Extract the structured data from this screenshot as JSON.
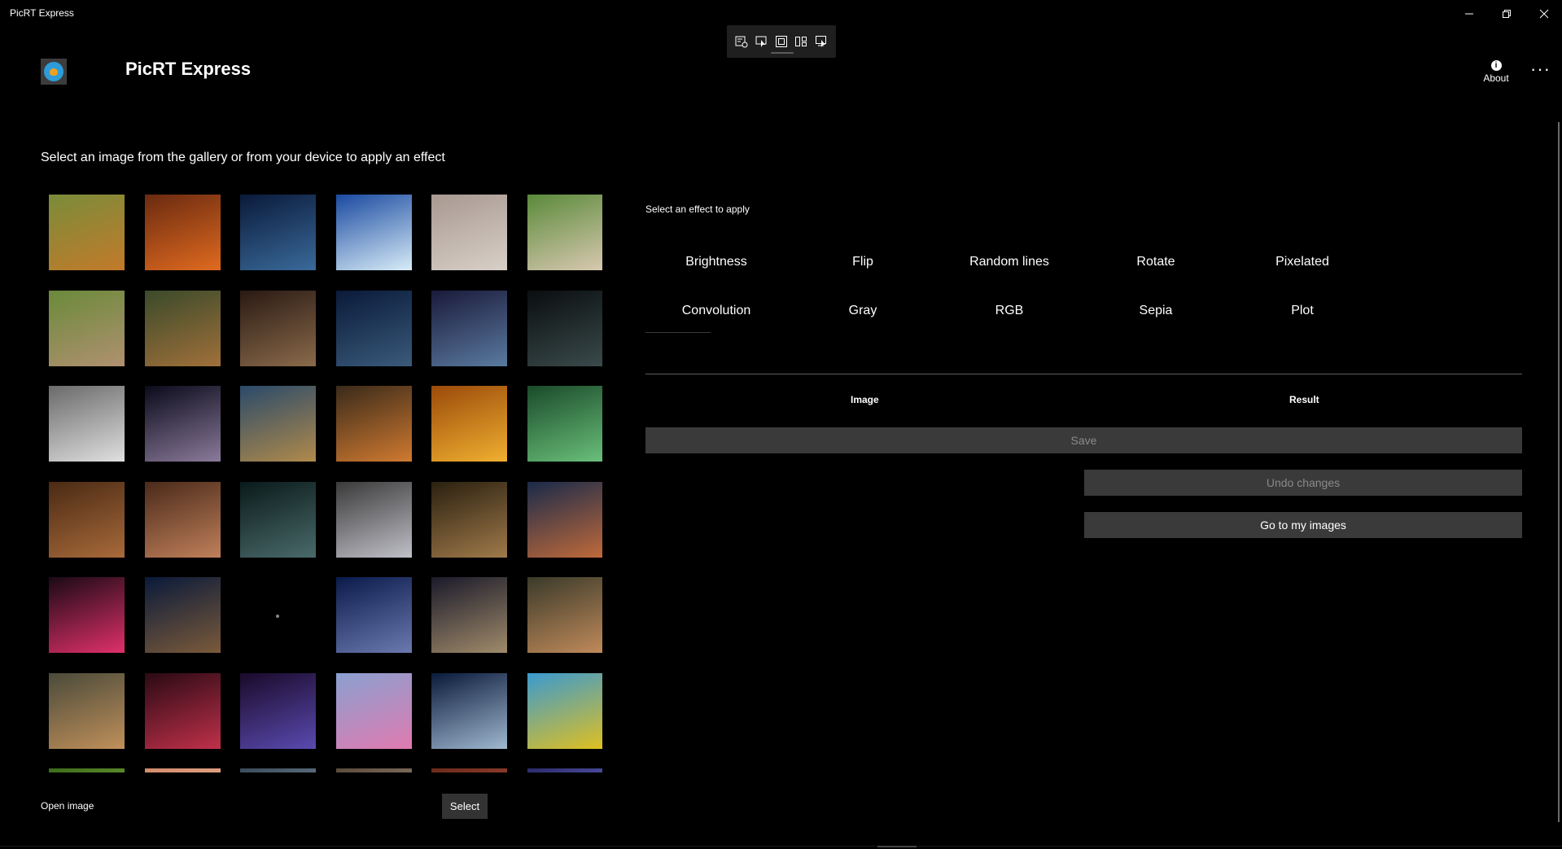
{
  "window": {
    "title": "PicRT Express",
    "controls": [
      "minimize-icon",
      "restore-icon",
      "close-icon"
    ]
  },
  "dev_toolbar": {
    "icons": [
      "toggle-visual-tree-icon",
      "select-element-icon",
      "display-layout-adorners-icon",
      "track-focused-element-icon",
      "hot-reload-icon"
    ]
  },
  "header": {
    "app_name": "PicRT Express",
    "about_label": "About",
    "more_label": "···"
  },
  "instruction": "Select an image from the gallery or from your device to apply an effect",
  "gallery": {
    "thumbnails": [
      {
        "name": "corgi",
        "c1": "#7a8c3a",
        "c2": "#c27a2a"
      },
      {
        "name": "cave-sunset",
        "c1": "#6a2a10",
        "c2": "#e06a20"
      },
      {
        "name": "starry-sky-rock",
        "c1": "#0a1a3a",
        "c2": "#3a6a9a"
      },
      {
        "name": "glacier",
        "c1": "#1a4aa0",
        "c2": "#d8ecf8"
      },
      {
        "name": "cat",
        "c1": "#a89890",
        "c2": "#d8d0c8"
      },
      {
        "name": "rabbit",
        "c1": "#5a8a3a",
        "c2": "#d8c8b0"
      },
      {
        "name": "cat-in-grass",
        "c1": "#6a8a3a",
        "c2": "#b09070"
      },
      {
        "name": "tiger-lying",
        "c1": "#3a4a2a",
        "c2": "#a0703a"
      },
      {
        "name": "abandoned-room",
        "c1": "#2a1a14",
        "c2": "#8a6a4a"
      },
      {
        "name": "old-train",
        "c1": "#0a1a3a",
        "c2": "#3a5a7a"
      },
      {
        "name": "tent-night",
        "c1": "#1a1a3a",
        "c2": "#5a7aa0"
      },
      {
        "name": "dark-coast",
        "c1": "#0a0e10",
        "c2": "#3a4a4a"
      },
      {
        "name": "goats-snow",
        "c1": "#6a6a6a",
        "c2": "#e0e0e0"
      },
      {
        "name": "space-planet",
        "c1": "#0a0a1a",
        "c2": "#8a7a9a"
      },
      {
        "name": "owl-autumn",
        "c1": "#2a4a6a",
        "c2": "#b08a4a"
      },
      {
        "name": "tiger-water",
        "c1": "#3a2a1a",
        "c2": "#d07a30"
      },
      {
        "name": "golden-valley",
        "c1": "#9a4a0a",
        "c2": "#f0b030"
      },
      {
        "name": "circuit-board",
        "c1": "#1a4a2a",
        "c2": "#6ac07a"
      },
      {
        "name": "bolt-wood",
        "c1": "#4a2a14",
        "c2": "#a86a3a"
      },
      {
        "name": "mars-rover",
        "c1": "#4a2a1a",
        "c2": "#c0805a"
      },
      {
        "name": "tunnel",
        "c1": "#0a1a1a",
        "c2": "#4a6a6a"
      },
      {
        "name": "foggy-sea",
        "c1": "#3a3a3a",
        "c2": "#c0c0c8"
      },
      {
        "name": "lighthouse-ufo",
        "c1": "#2a2010",
        "c2": "#a07a4a"
      },
      {
        "name": "bridge",
        "c1": "#1a2a4a",
        "c2": "#c06a3a"
      },
      {
        "name": "neon-sign",
        "c1": "#1a0a14",
        "c2": "#e0306a"
      },
      {
        "name": "mountain-night",
        "c1": "#0a1a3a",
        "c2": "#7a5a3a"
      },
      {
        "name": "dark-empty",
        "c1": "#000000",
        "c2": "#0a0a0a"
      },
      {
        "name": "blue-mountains",
        "c1": "#0a1a4a",
        "c2": "#6a7ab0"
      },
      {
        "name": "stormy-sea",
        "c1": "#1a1a2a",
        "c2": "#a08a6a"
      },
      {
        "name": "mountain-clouds",
        "c1": "#3a3a2a",
        "c2": "#c08a5a"
      },
      {
        "name": "desert-dunes",
        "c1": "#4a4a3a",
        "c2": "#c0905a"
      },
      {
        "name": "berries",
        "c1": "#2a0a14",
        "c2": "#c0304a"
      },
      {
        "name": "cave-glow",
        "c1": "#1a0a2a",
        "c2": "#5a4ab0"
      },
      {
        "name": "pink-flowers",
        "c1": "#8aa0d0",
        "c2": "#e07ab0"
      },
      {
        "name": "snowy-lake",
        "c1": "#0a1a3a",
        "c2": "#a0b8d0"
      },
      {
        "name": "yellow-bird",
        "c1": "#3a9ad0",
        "c2": "#e0c020"
      },
      {
        "name": "partial-1",
        "c1": "#3a6a1a",
        "c2": "#5a8a2a"
      },
      {
        "name": "partial-2",
        "c1": "#d08a6a",
        "c2": "#e0a080"
      },
      {
        "name": "partial-3",
        "c1": "#3a4a5a",
        "c2": "#5a6a7a"
      },
      {
        "name": "partial-4",
        "c1": "#5a4a3a",
        "c2": "#7a6a5a"
      },
      {
        "name": "partial-5",
        "c1": "#6a2a1a",
        "c2": "#8a3a2a"
      },
      {
        "name": "partial-6",
        "c1": "#2a2a6a",
        "c2": "#4a4a9a"
      }
    ]
  },
  "bottom": {
    "open_image_label": "Open image",
    "select_label": "Select"
  },
  "effects": {
    "title": "Select an effect to apply",
    "rows": [
      [
        "Brightness",
        "Flip",
        "Random lines",
        "Rotate",
        "Pixelated"
      ],
      [
        "Convolution",
        "Gray",
        "RGB",
        "Sepia",
        "Plot"
      ]
    ]
  },
  "preview": {
    "image_header": "Image",
    "result_header": "Result",
    "save_label": "Save",
    "undo_label": "Undo changes",
    "goto_label": "Go to my images"
  }
}
